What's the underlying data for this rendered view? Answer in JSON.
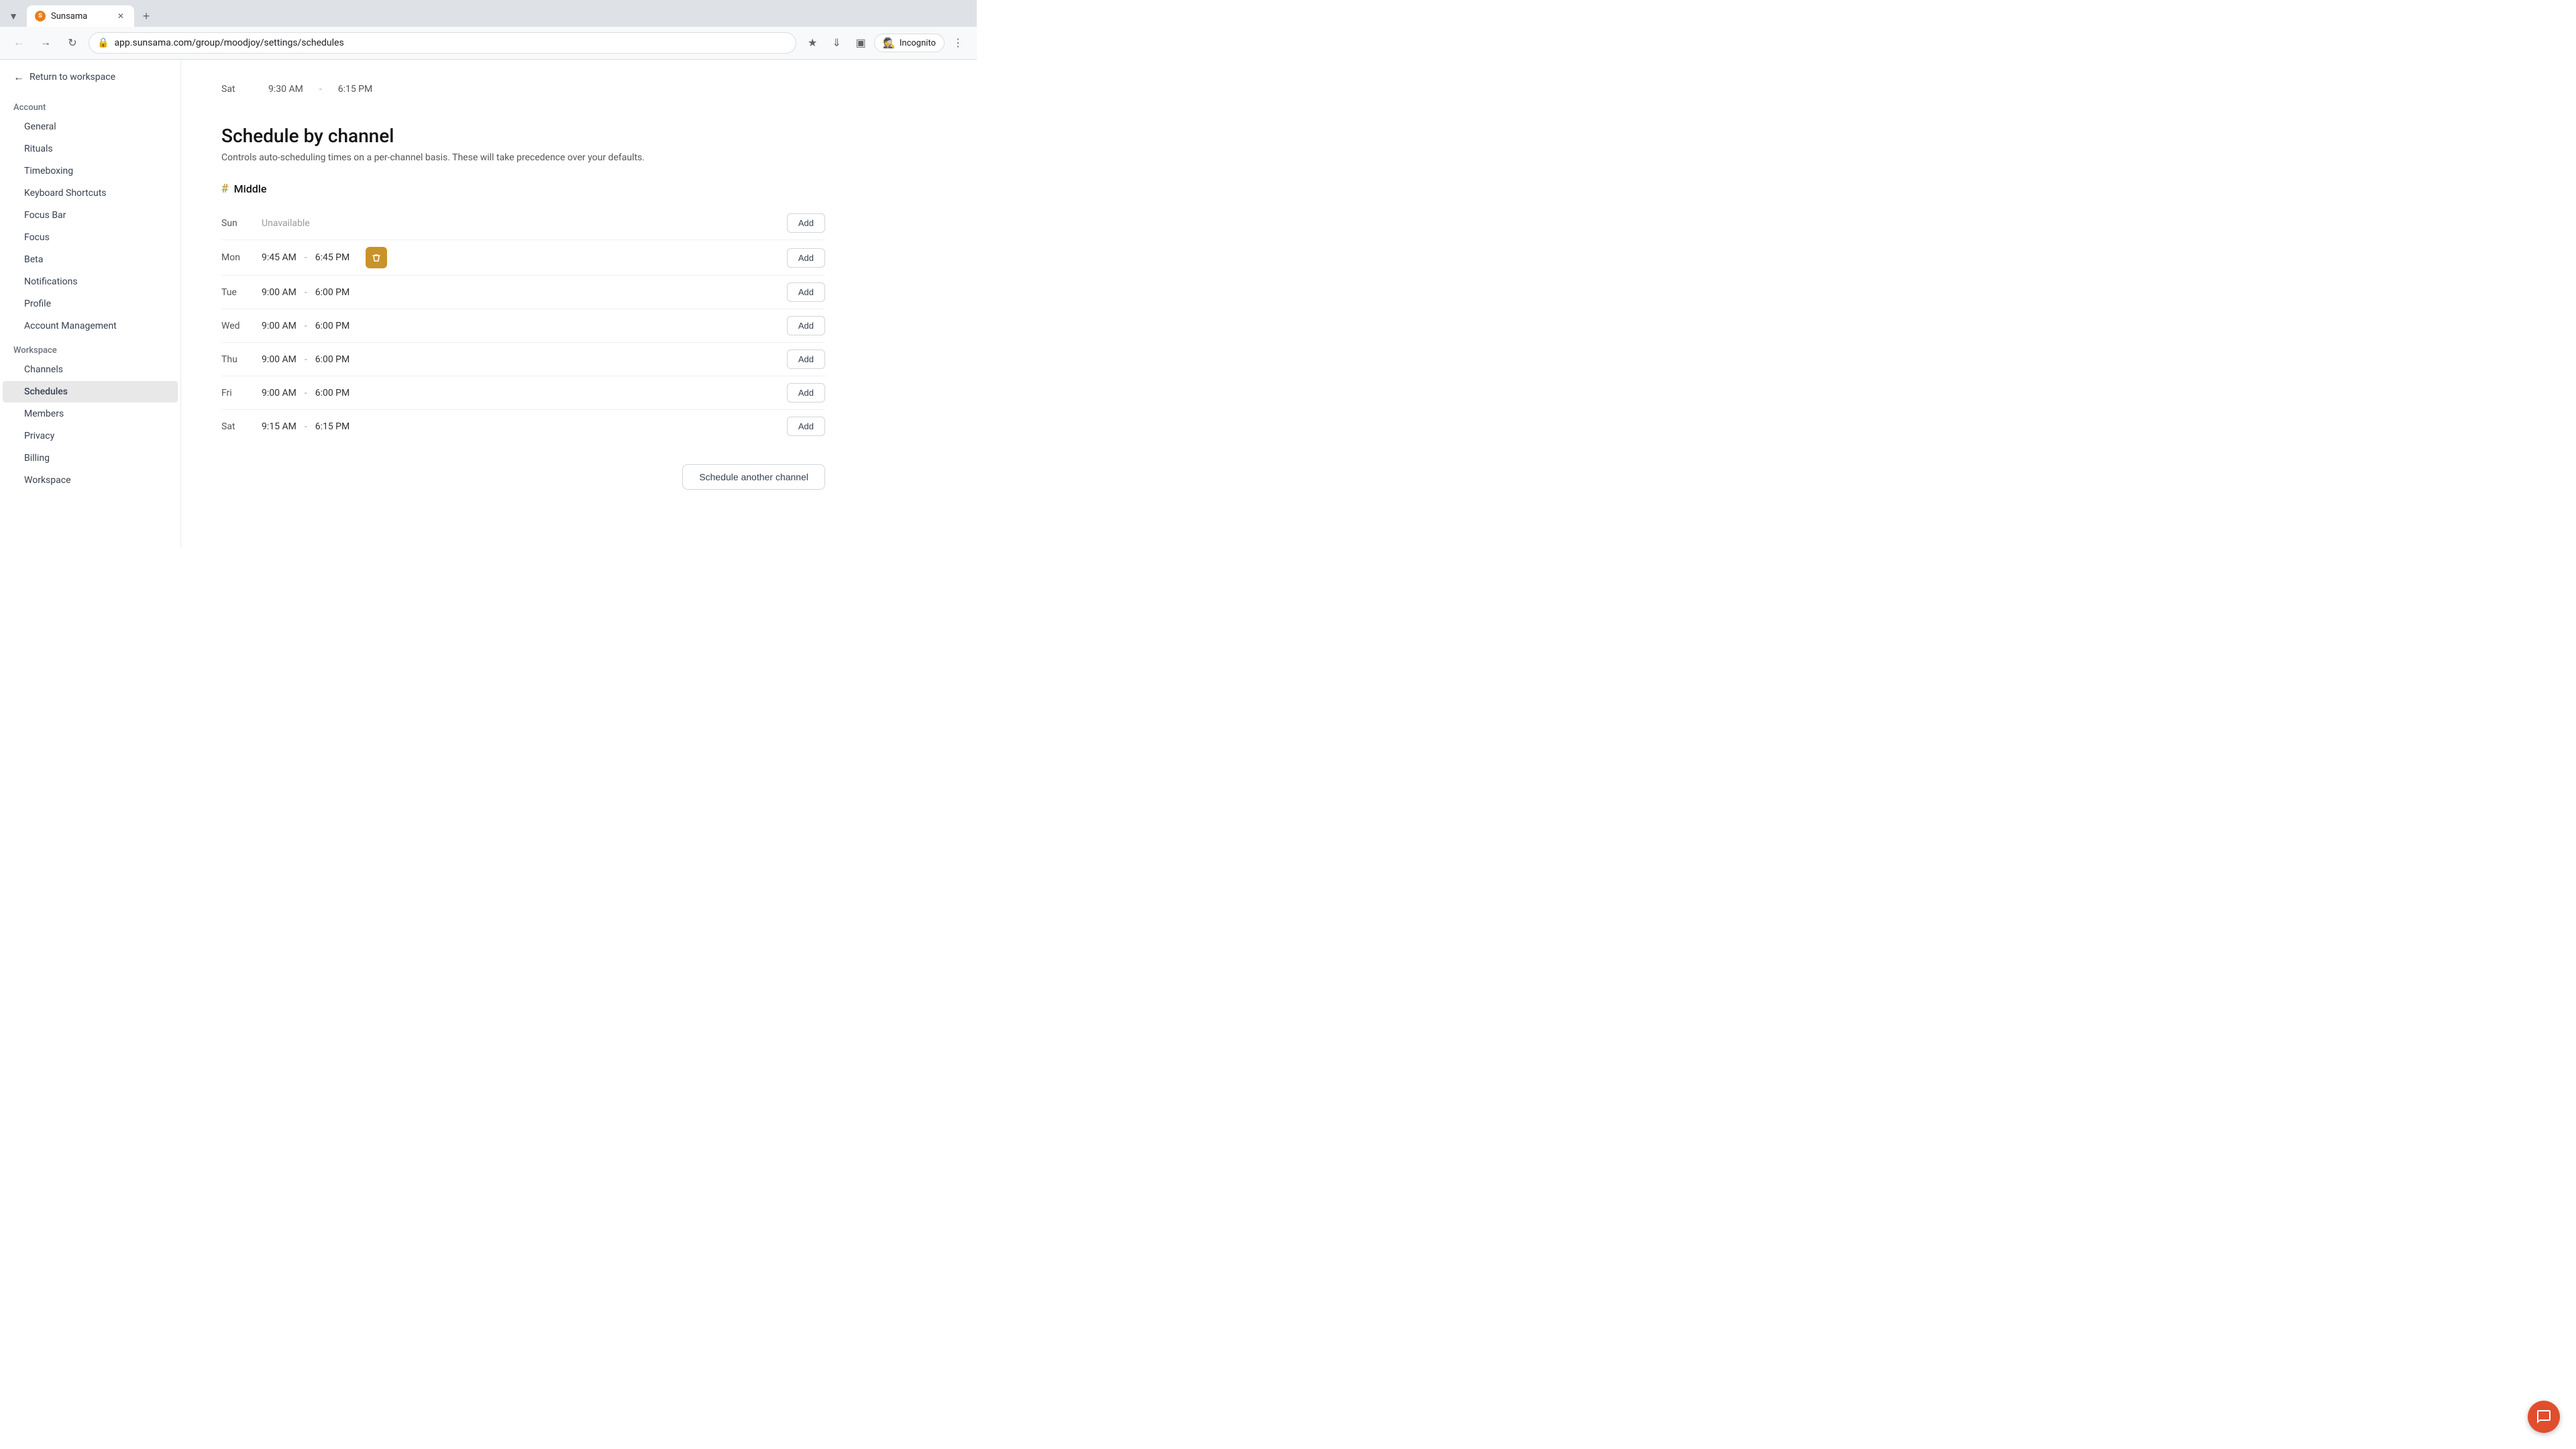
{
  "browser": {
    "tab_title": "Sunsama",
    "tab_favicon": "S",
    "address": "app.sunsama.com/group/moodjoy/settings/schedules",
    "incognito_label": "Incognito"
  },
  "sidebar": {
    "return_label": "Return to workspace",
    "account_section": "Account",
    "workspace_section": "Workspace",
    "account_items": [
      {
        "id": "general",
        "label": "General"
      },
      {
        "id": "rituals",
        "label": "Rituals"
      },
      {
        "id": "timeboxing",
        "label": "Timeboxing"
      },
      {
        "id": "keyboard-shortcuts",
        "label": "Keyboard Shortcuts"
      },
      {
        "id": "focus-bar",
        "label": "Focus Bar"
      },
      {
        "id": "focus",
        "label": "Focus"
      },
      {
        "id": "beta",
        "label": "Beta"
      },
      {
        "id": "notifications",
        "label": "Notifications"
      },
      {
        "id": "profile",
        "label": "Profile"
      },
      {
        "id": "account-management",
        "label": "Account Management"
      }
    ],
    "workspace_items": [
      {
        "id": "channels",
        "label": "Channels"
      },
      {
        "id": "schedules",
        "label": "Schedules",
        "active": true
      },
      {
        "id": "members",
        "label": "Members"
      },
      {
        "id": "privacy",
        "label": "Privacy"
      },
      {
        "id": "billing",
        "label": "Billing"
      },
      {
        "id": "workspace",
        "label": "Workspace"
      }
    ]
  },
  "main": {
    "top_scroll": {
      "day": "Sat",
      "start": "9:30 AM",
      "separator": "-",
      "end": "6:15 PM"
    },
    "section_title": "Schedule by channel",
    "section_desc": "Controls auto-scheduling times on a per-channel basis. These will take precedence over your defaults.",
    "channel": {
      "hash": "#",
      "name": "Middle"
    },
    "schedule_rows": [
      {
        "day": "Sun",
        "unavailable": true,
        "unavailable_text": "Unavailable",
        "show_delete": false
      },
      {
        "day": "Mon",
        "start": "9:45 AM",
        "end": "6:45 PM",
        "unavailable": false,
        "show_delete": true
      },
      {
        "day": "Tue",
        "start": "9:00 AM",
        "end": "6:00 PM",
        "unavailable": false,
        "show_delete": false
      },
      {
        "day": "Wed",
        "start": "9:00 AM",
        "end": "6:00 PM",
        "unavailable": false,
        "show_delete": false
      },
      {
        "day": "Thu",
        "start": "9:00 AM",
        "end": "6:00 PM",
        "unavailable": false,
        "show_delete": false
      },
      {
        "day": "Fri",
        "start": "9:00 AM",
        "end": "6:00 PM",
        "unavailable": false,
        "show_delete": false
      },
      {
        "day": "Sat",
        "start": "9:15 AM",
        "end": "6:15 PM",
        "unavailable": false,
        "show_delete": false
      }
    ],
    "add_btn_label": "Add",
    "schedule_another_btn": "Schedule another channel",
    "time_separator": "-"
  }
}
